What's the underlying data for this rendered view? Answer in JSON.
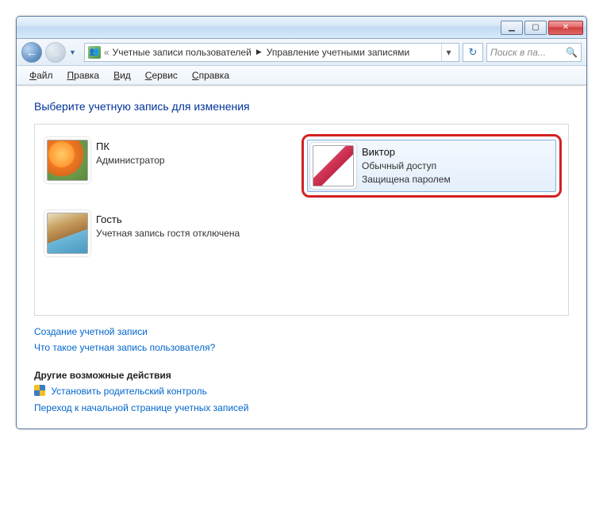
{
  "titlebar": {},
  "nav": {
    "breadcrumb_prefix": "«",
    "crumb1": "Учетные записи пользователей",
    "crumb2": "Управление учетными записями",
    "search_placeholder": "Поиск в па..."
  },
  "menu": {
    "file": "Файл",
    "edit": "Правка",
    "view": "Вид",
    "tools": "Сервис",
    "help": "Справка"
  },
  "heading": "Выберите учетную запись для изменения",
  "accounts": [
    {
      "name": "ПК",
      "line1": "Администратор",
      "line2": ""
    },
    {
      "name": "Виктор",
      "line1": "Обычный доступ",
      "line2": "Защищена паролем"
    },
    {
      "name": "Гость",
      "line1": "Учетная запись гостя отключена",
      "line2": ""
    }
  ],
  "links": {
    "create": "Создание учетной записи",
    "whatis": "Что такое учетная запись пользователя?",
    "other_heading": "Другие возможные действия",
    "parental": "Установить родительский контроль",
    "gohome": "Переход к начальной странице учетных записей"
  }
}
